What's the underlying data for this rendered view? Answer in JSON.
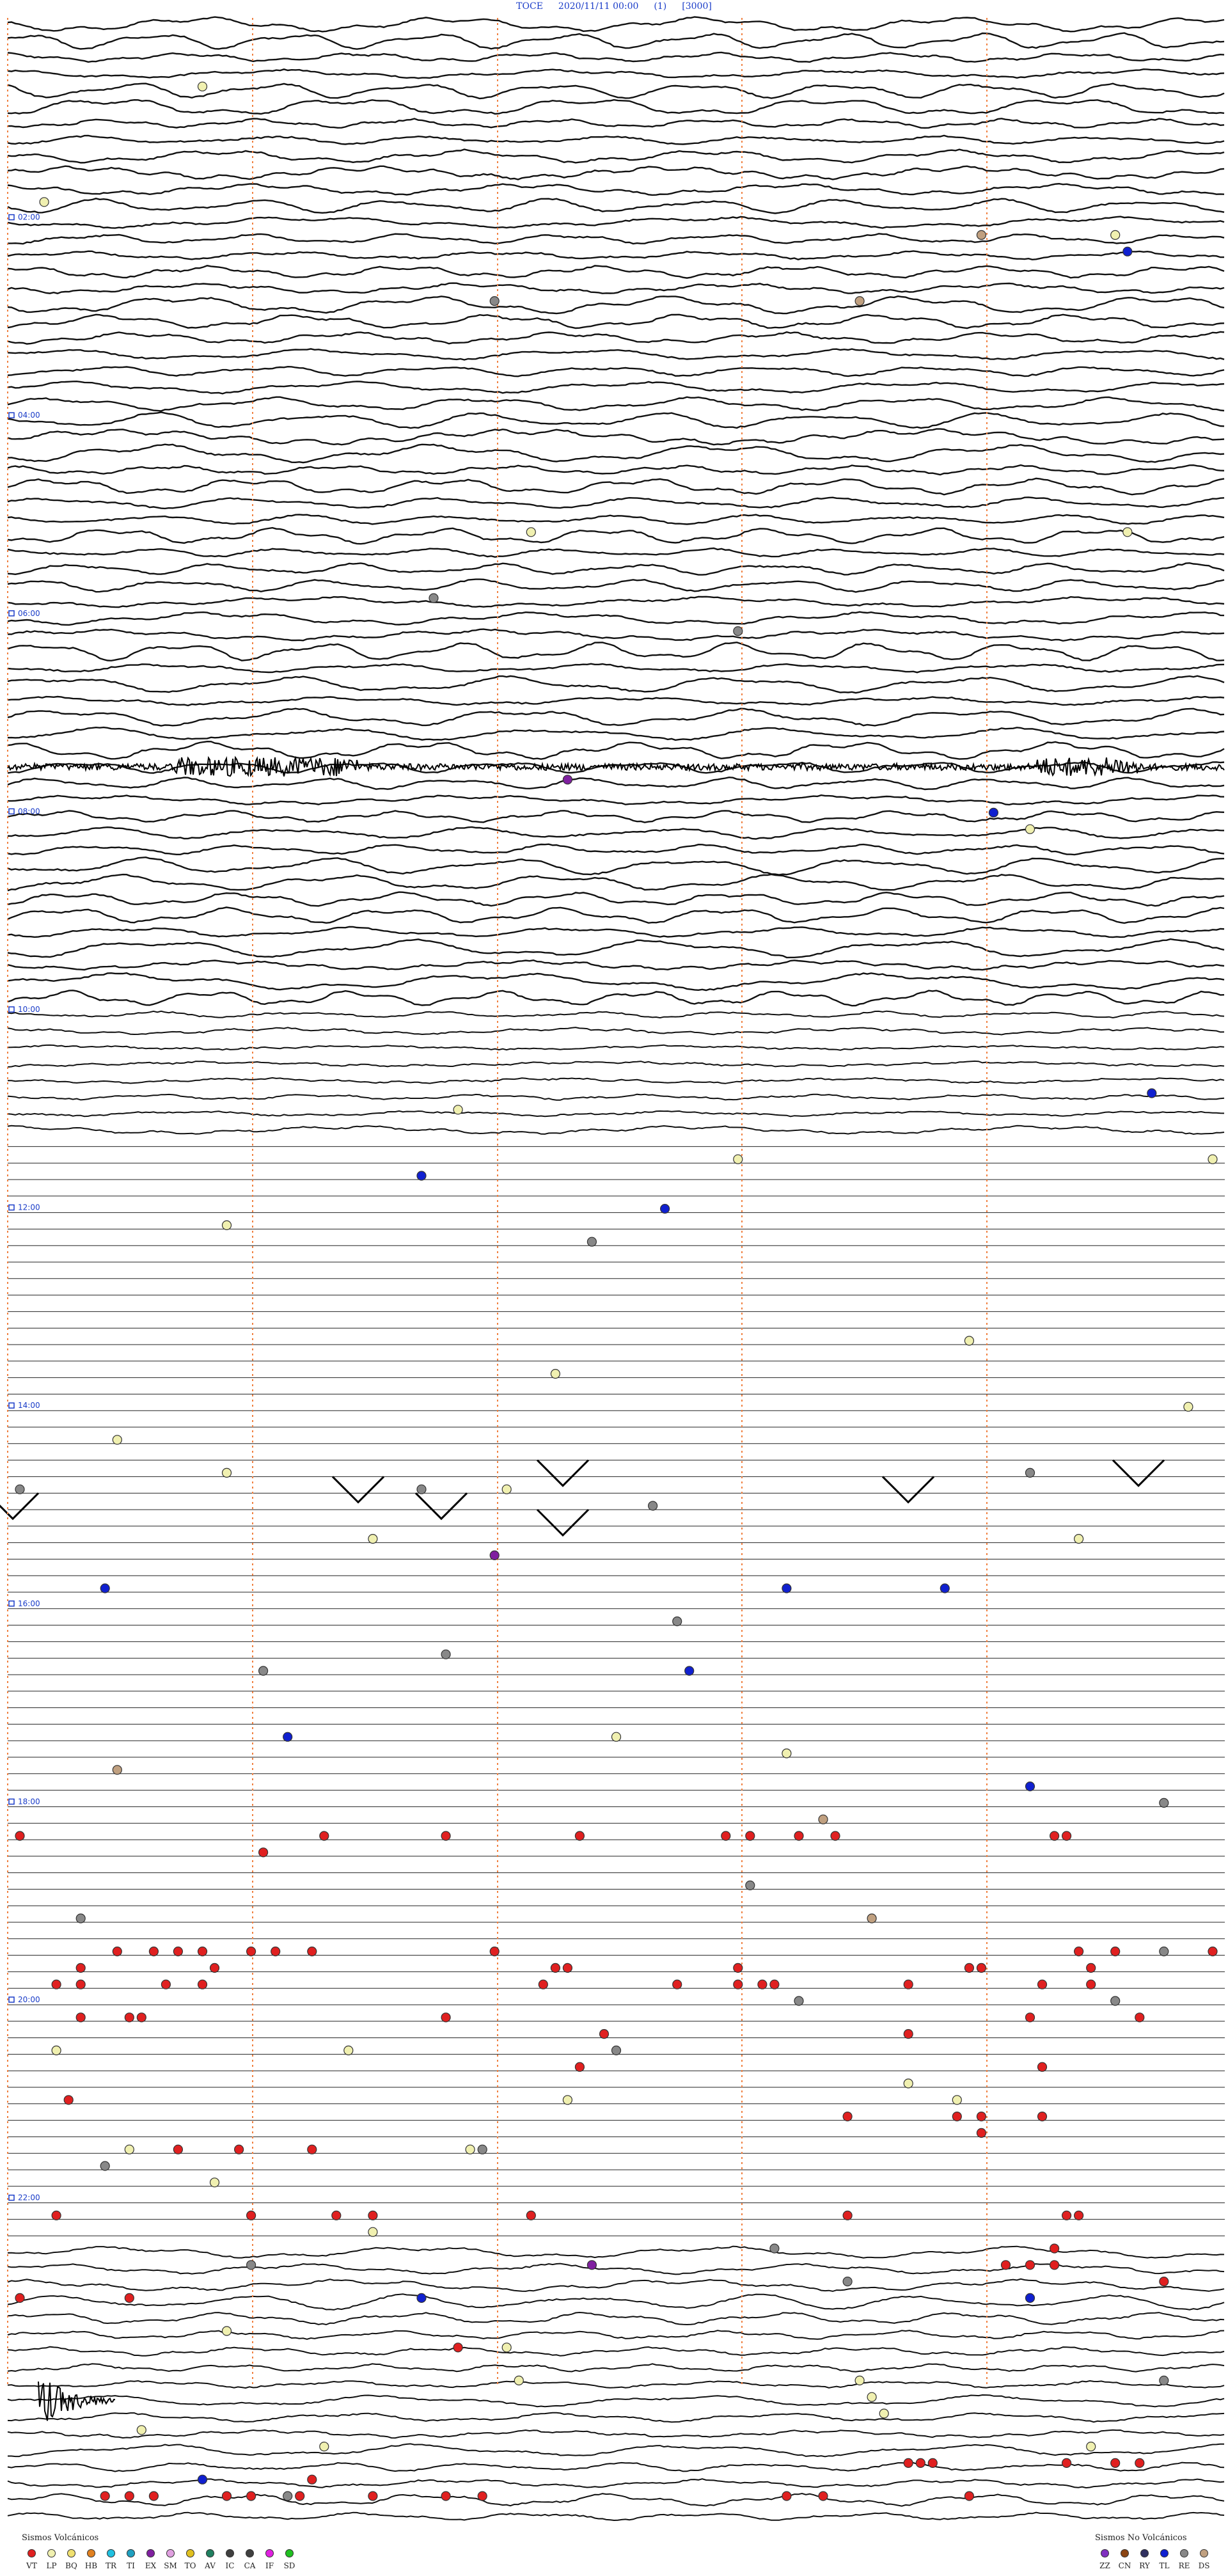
{
  "header": {
    "station": "TOCE",
    "datetime": "2020/11/11 00:00",
    "component": "(1)",
    "scale": "[3000]"
  },
  "chart_data": {
    "type": "helicorder",
    "time_labels": [
      "02:00",
      "04:00",
      "06:00",
      "08:00",
      "10:00",
      "12:00",
      "14:00",
      "16:00",
      "18:00",
      "20:00",
      "22:00"
    ],
    "num_lines": 96,
    "marker_colors": {
      "VT": "#e02020",
      "LP": "#f0f0b0",
      "BQ": "#f0e070",
      "HB": "#e08020",
      "TR": "#20c0e0",
      "TI": "#20a0c0",
      "EX": "#8020a0",
      "SM": "#e0a0e0",
      "TO": "#e0c020",
      "AV": "#208060",
      "IC": "#404040",
      "CA": "#404040",
      "IF": "#e020e0",
      "SD": "#20c020",
      "ZZ": "#8030c0",
      "CN": "#8b4513",
      "RY": "#303060",
      "TL": "#1020d0",
      "RE": "#888888",
      "DS": "#c0a080"
    },
    "events": [
      {
        "line": 4,
        "x": 0.16,
        "cls": "LP"
      },
      {
        "line": 11,
        "x": 0.03,
        "cls": "LP"
      },
      {
        "line": 13,
        "x": 0.8,
        "cls": "DS"
      },
      {
        "line": 13,
        "x": 0.91,
        "cls": "LP"
      },
      {
        "line": 14,
        "x": 0.92,
        "cls": "TL"
      },
      {
        "line": 17,
        "x": 0.4,
        "cls": "RE"
      },
      {
        "line": 17,
        "x": 0.7,
        "cls": "DS"
      },
      {
        "line": 31,
        "x": 0.43,
        "cls": "LP"
      },
      {
        "line": 31,
        "x": 0.92,
        "cls": "LP"
      },
      {
        "line": 35,
        "x": 0.35,
        "cls": "RE"
      },
      {
        "line": 37,
        "x": 0.6,
        "cls": "RE"
      },
      {
        "line": 46,
        "x": 0.46,
        "cls": "EX"
      },
      {
        "line": 48,
        "x": 0.81,
        "cls": "TL"
      },
      {
        "line": 49,
        "x": 0.84,
        "cls": "LP"
      },
      {
        "line": 65,
        "x": 0.94,
        "cls": "TL"
      },
      {
        "line": 66,
        "x": 0.37,
        "cls": "LP"
      },
      {
        "line": 69,
        "x": 0.6,
        "cls": "LP"
      },
      {
        "line": 69,
        "x": 0.99,
        "cls": "LP"
      },
      {
        "line": 70,
        "x": 0.34,
        "cls": "TL"
      },
      {
        "line": 72,
        "x": 0.54,
        "cls": "TL"
      },
      {
        "line": 73,
        "x": 0.18,
        "cls": "LP"
      },
      {
        "line": 74,
        "x": 0.48,
        "cls": "RE"
      },
      {
        "line": 80,
        "x": 0.79,
        "cls": "LP"
      },
      {
        "line": 82,
        "x": 0.45,
        "cls": "LP"
      },
      {
        "line": 84,
        "x": 0.97,
        "cls": "LP"
      },
      {
        "line": 86,
        "x": 0.09,
        "cls": "LP"
      },
      {
        "line": 88,
        "x": 0.18,
        "cls": "LP"
      },
      {
        "line": 88,
        "x": 0.84,
        "cls": "RE"
      },
      {
        "line": 89,
        "x": 0.01,
        "cls": "RE"
      },
      {
        "line": 89,
        "x": 0.34,
        "cls": "RE"
      },
      {
        "line": 89,
        "x": 0.41,
        "cls": "LP"
      },
      {
        "line": 90,
        "x": 0.53,
        "cls": "RE"
      },
      {
        "line": 92,
        "x": 0.3,
        "cls": "LP"
      },
      {
        "line": 92,
        "x": 0.88,
        "cls": "LP"
      },
      {
        "line": 93,
        "x": 0.4,
        "cls": "EX"
      },
      {
        "line": 95,
        "x": 0.08,
        "cls": "TL"
      },
      {
        "line": 95,
        "x": 0.64,
        "cls": "TL"
      },
      {
        "line": 95,
        "x": 0.77,
        "cls": "TL"
      },
      {
        "line": 97,
        "x": 0.55,
        "cls": "RE"
      },
      {
        "line": 99,
        "x": 0.36,
        "cls": "RE"
      },
      {
        "line": 100,
        "x": 0.21,
        "cls": "RE"
      },
      {
        "line": 100,
        "x": 0.56,
        "cls": "TL"
      },
      {
        "line": 104,
        "x": 0.23,
        "cls": "TL"
      },
      {
        "line": 104,
        "x": 0.5,
        "cls": "LP"
      },
      {
        "line": 105,
        "x": 0.64,
        "cls": "LP"
      },
      {
        "line": 106,
        "x": 0.09,
        "cls": "DS"
      },
      {
        "line": 107,
        "x": 0.84,
        "cls": "TL"
      },
      {
        "line": 108,
        "x": 0.95,
        "cls": "RE"
      },
      {
        "line": 109,
        "x": 0.67,
        "cls": "DS"
      },
      {
        "line": 110,
        "x": 0.01,
        "cls": "VT"
      },
      {
        "line": 110,
        "x": 0.26,
        "cls": "VT"
      },
      {
        "line": 110,
        "x": 0.36,
        "cls": "VT"
      },
      {
        "line": 110,
        "x": 0.47,
        "cls": "VT"
      },
      {
        "line": 110,
        "x": 0.59,
        "cls": "VT"
      },
      {
        "line": 110,
        "x": 0.61,
        "cls": "VT"
      },
      {
        "line": 110,
        "x": 0.65,
        "cls": "VT"
      },
      {
        "line": 110,
        "x": 0.68,
        "cls": "VT"
      },
      {
        "line": 110,
        "x": 0.86,
        "cls": "VT"
      },
      {
        "line": 110,
        "x": 0.87,
        "cls": "VT"
      },
      {
        "line": 111,
        "x": 0.21,
        "cls": "VT"
      },
      {
        "line": 113,
        "x": 0.61,
        "cls": "RE"
      },
      {
        "line": 115,
        "x": 0.06,
        "cls": "RE"
      },
      {
        "line": 115,
        "x": 0.71,
        "cls": "DS"
      },
      {
        "line": 117,
        "x": 0.09,
        "cls": "VT"
      },
      {
        "line": 117,
        "x": 0.12,
        "cls": "VT"
      },
      {
        "line": 117,
        "x": 0.14,
        "cls": "VT"
      },
      {
        "line": 117,
        "x": 0.16,
        "cls": "VT"
      },
      {
        "line": 117,
        "x": 0.2,
        "cls": "VT"
      },
      {
        "line": 117,
        "x": 0.22,
        "cls": "VT"
      },
      {
        "line": 117,
        "x": 0.25,
        "cls": "VT"
      },
      {
        "line": 117,
        "x": 0.4,
        "cls": "VT"
      },
      {
        "line": 117,
        "x": 0.88,
        "cls": "VT"
      },
      {
        "line": 117,
        "x": 0.91,
        "cls": "VT"
      },
      {
        "line": 117,
        "x": 0.95,
        "cls": "RE"
      },
      {
        "line": 117,
        "x": 0.99,
        "cls": "VT"
      },
      {
        "line": 118,
        "x": 0.06,
        "cls": "VT"
      },
      {
        "line": 118,
        "x": 0.17,
        "cls": "VT"
      },
      {
        "line": 118,
        "x": 0.45,
        "cls": "VT"
      },
      {
        "line": 118,
        "x": 0.46,
        "cls": "VT"
      },
      {
        "line": 118,
        "x": 0.6,
        "cls": "VT"
      },
      {
        "line": 118,
        "x": 0.79,
        "cls": "VT"
      },
      {
        "line": 118,
        "x": 0.8,
        "cls": "VT"
      },
      {
        "line": 118,
        "x": 0.89,
        "cls": "VT"
      },
      {
        "line": 119,
        "x": 0.04,
        "cls": "VT"
      },
      {
        "line": 119,
        "x": 0.06,
        "cls": "VT"
      },
      {
        "line": 119,
        "x": 0.13,
        "cls": "VT"
      },
      {
        "line": 119,
        "x": 0.16,
        "cls": "VT"
      },
      {
        "line": 119,
        "x": 0.44,
        "cls": "VT"
      },
      {
        "line": 119,
        "x": 0.55,
        "cls": "VT"
      },
      {
        "line": 119,
        "x": 0.6,
        "cls": "VT"
      },
      {
        "line": 119,
        "x": 0.62,
        "cls": "VT"
      },
      {
        "line": 119,
        "x": 0.63,
        "cls": "VT"
      },
      {
        "line": 119,
        "x": 0.74,
        "cls": "VT"
      },
      {
        "line": 119,
        "x": 0.85,
        "cls": "VT"
      },
      {
        "line": 119,
        "x": 0.89,
        "cls": "VT"
      },
      {
        "line": 120,
        "x": 0.65,
        "cls": "RE"
      },
      {
        "line": 120,
        "x": 0.91,
        "cls": "RE"
      },
      {
        "line": 121,
        "x": 0.06,
        "cls": "VT"
      },
      {
        "line": 121,
        "x": 0.1,
        "cls": "VT"
      },
      {
        "line": 121,
        "x": 0.11,
        "cls": "VT"
      },
      {
        "line": 121,
        "x": 0.36,
        "cls": "VT"
      },
      {
        "line": 121,
        "x": 0.84,
        "cls": "VT"
      },
      {
        "line": 121,
        "x": 0.93,
        "cls": "VT"
      },
      {
        "line": 122,
        "x": 0.49,
        "cls": "VT"
      },
      {
        "line": 122,
        "x": 0.74,
        "cls": "VT"
      },
      {
        "line": 123,
        "x": 0.04,
        "cls": "LP"
      },
      {
        "line": 123,
        "x": 0.28,
        "cls": "LP"
      },
      {
        "line": 123,
        "x": 0.5,
        "cls": "RE"
      },
      {
        "line": 124,
        "x": 0.47,
        "cls": "VT"
      },
      {
        "line": 124,
        "x": 0.85,
        "cls": "VT"
      },
      {
        "line": 125,
        "x": 0.74,
        "cls": "LP"
      },
      {
        "line": 126,
        "x": 0.05,
        "cls": "VT"
      },
      {
        "line": 126,
        "x": 0.46,
        "cls": "LP"
      },
      {
        "line": 126,
        "x": 0.78,
        "cls": "LP"
      },
      {
        "line": 127,
        "x": 0.69,
        "cls": "VT"
      },
      {
        "line": 127,
        "x": 0.78,
        "cls": "VT"
      },
      {
        "line": 127,
        "x": 0.8,
        "cls": "VT"
      },
      {
        "line": 127,
        "x": 0.85,
        "cls": "VT"
      },
      {
        "line": 128,
        "x": 0.8,
        "cls": "VT"
      },
      {
        "line": 129,
        "x": 0.1,
        "cls": "LP"
      },
      {
        "line": 129,
        "x": 0.14,
        "cls": "VT"
      },
      {
        "line": 129,
        "x": 0.19,
        "cls": "VT"
      },
      {
        "line": 129,
        "x": 0.25,
        "cls": "VT"
      },
      {
        "line": 129,
        "x": 0.38,
        "cls": "LP"
      },
      {
        "line": 129,
        "x": 0.39,
        "cls": "RE"
      },
      {
        "line": 130,
        "x": 0.08,
        "cls": "RE"
      },
      {
        "line": 131,
        "x": 0.17,
        "cls": "LP"
      },
      {
        "line": 133,
        "x": 0.04,
        "cls": "VT"
      },
      {
        "line": 133,
        "x": 0.2,
        "cls": "VT"
      },
      {
        "line": 133,
        "x": 0.27,
        "cls": "VT"
      },
      {
        "line": 133,
        "x": 0.3,
        "cls": "VT"
      },
      {
        "line": 133,
        "x": 0.43,
        "cls": "VT"
      },
      {
        "line": 133,
        "x": 0.69,
        "cls": "VT"
      },
      {
        "line": 133,
        "x": 0.87,
        "cls": "VT"
      },
      {
        "line": 133,
        "x": 0.88,
        "cls": "VT"
      },
      {
        "line": 134,
        "x": 0.3,
        "cls": "LP"
      },
      {
        "line": 135,
        "x": 0.63,
        "cls": "RE"
      },
      {
        "line": 135,
        "x": 0.86,
        "cls": "VT"
      },
      {
        "line": 136,
        "x": 0.2,
        "cls": "RE"
      },
      {
        "line": 136,
        "x": 0.48,
        "cls": "EX"
      },
      {
        "line": 136,
        "x": 0.82,
        "cls": "VT"
      },
      {
        "line": 136,
        "x": 0.84,
        "cls": "VT"
      },
      {
        "line": 136,
        "x": 0.86,
        "cls": "VT"
      },
      {
        "line": 137,
        "x": 0.69,
        "cls": "RE"
      },
      {
        "line": 137,
        "x": 0.95,
        "cls": "VT"
      },
      {
        "line": 138,
        "x": 0.01,
        "cls": "VT"
      },
      {
        "line": 138,
        "x": 0.1,
        "cls": "VT"
      },
      {
        "line": 138,
        "x": 0.34,
        "cls": "TL"
      },
      {
        "line": 138,
        "x": 0.84,
        "cls": "TL"
      },
      {
        "line": 140,
        "x": 0.18,
        "cls": "LP"
      },
      {
        "line": 141,
        "x": 0.37,
        "cls": "VT"
      },
      {
        "line": 141,
        "x": 0.41,
        "cls": "LP"
      },
      {
        "line": 143,
        "x": 0.42,
        "cls": "LP"
      },
      {
        "line": 143,
        "x": 0.7,
        "cls": "LP"
      },
      {
        "line": 143,
        "x": 0.95,
        "cls": "RE"
      },
      {
        "line": 144,
        "x": 0.71,
        "cls": "LP"
      },
      {
        "line": 145,
        "x": 0.72,
        "cls": "LP"
      },
      {
        "line": 146,
        "x": 0.11,
        "cls": "LP"
      },
      {
        "line": 147,
        "x": 0.26,
        "cls": "LP"
      },
      {
        "line": 147,
        "x": 0.89,
        "cls": "LP"
      },
      {
        "line": 148,
        "x": 0.74,
        "cls": "VT"
      },
      {
        "line": 148,
        "x": 0.75,
        "cls": "VT"
      },
      {
        "line": 148,
        "x": 0.76,
        "cls": "VT"
      },
      {
        "line": 148,
        "x": 0.87,
        "cls": "VT"
      },
      {
        "line": 148,
        "x": 0.91,
        "cls": "VT"
      },
      {
        "line": 148,
        "x": 0.93,
        "cls": "VT"
      },
      {
        "line": 149,
        "x": 0.16,
        "cls": "TL"
      },
      {
        "line": 149,
        "x": 0.25,
        "cls": "VT"
      },
      {
        "line": 150,
        "x": 0.08,
        "cls": "VT"
      },
      {
        "line": 150,
        "x": 0.1,
        "cls": "VT"
      },
      {
        "line": 150,
        "x": 0.12,
        "cls": "VT"
      },
      {
        "line": 150,
        "x": 0.18,
        "cls": "VT"
      },
      {
        "line": 150,
        "x": 0.2,
        "cls": "VT"
      },
      {
        "line": 150,
        "x": 0.23,
        "cls": "RE"
      },
      {
        "line": 150,
        "x": 0.24,
        "cls": "VT"
      },
      {
        "line": 150,
        "x": 0.3,
        "cls": "VT"
      },
      {
        "line": 150,
        "x": 0.36,
        "cls": "VT"
      },
      {
        "line": 150,
        "x": 0.39,
        "cls": "VT"
      },
      {
        "line": 150,
        "x": 0.64,
        "cls": "VT"
      },
      {
        "line": 150,
        "x": 0.67,
        "cls": "VT"
      },
      {
        "line": 150,
        "x": 0.79,
        "cls": "VT"
      }
    ],
    "legend_left": {
      "title": "Sismos Volcánicos",
      "items": [
        "VT",
        "LP",
        "BQ",
        "HB",
        "TR",
        "TI",
        "EX",
        "SM",
        "TO",
        "AV",
        "IC",
        "CA",
        "IF",
        "SD"
      ]
    },
    "legend_right": {
      "title": "Sismos No Volcánicos",
      "items": [
        "ZZ",
        "CN",
        "RY",
        "TL",
        "RE",
        "DS"
      ]
    }
  }
}
